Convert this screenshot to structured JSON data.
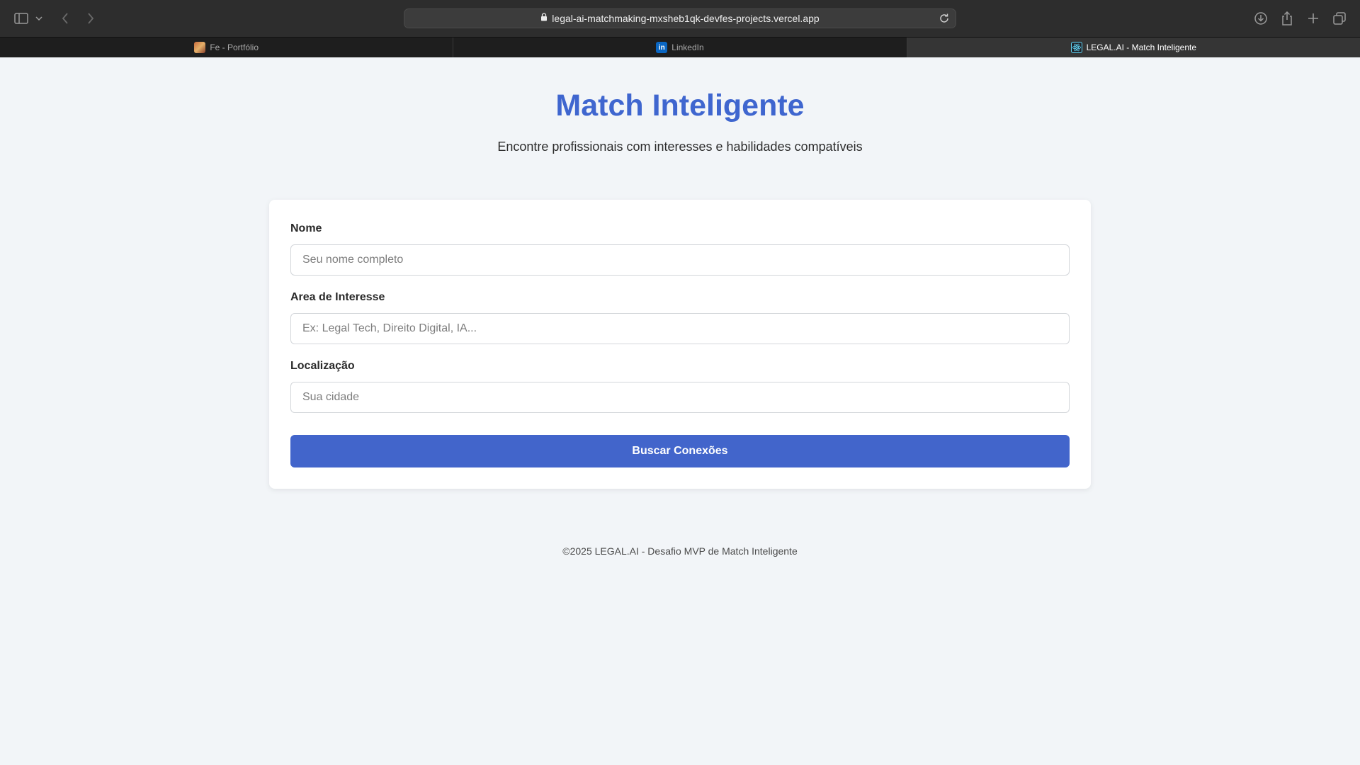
{
  "browser": {
    "url": "legal-ai-matchmaking-mxsheb1qk-devfes-projects.vercel.app",
    "tabs": [
      {
        "label": "Fe - Portfólio",
        "icon": "portfolio-favicon",
        "active": false
      },
      {
        "label": "LinkedIn",
        "icon": "linkedin-favicon",
        "active": false
      },
      {
        "label": "LEGAL.AI - Match Inteligente",
        "icon": "react-favicon",
        "active": true
      }
    ]
  },
  "page": {
    "title": "Match Inteligente",
    "subtitle": "Encontre profissionais com interesses e habilidades compatíveis"
  },
  "form": {
    "name": {
      "label": "Nome",
      "placeholder": "Seu nome completo",
      "value": ""
    },
    "interest": {
      "label": "Area de Interesse",
      "placeholder": "Ex: Legal Tech, Direito Digital, IA...",
      "value": ""
    },
    "location": {
      "label": "Localização",
      "placeholder": "Sua cidade",
      "value": ""
    },
    "submit_label": "Buscar Conexões"
  },
  "footer": {
    "text": "©2025 LEGAL.AI - Desafio MVP de Match Inteligente"
  },
  "colors": {
    "accent": "#4265cb",
    "title": "#3f66cf",
    "background": "#f2f5f8"
  }
}
